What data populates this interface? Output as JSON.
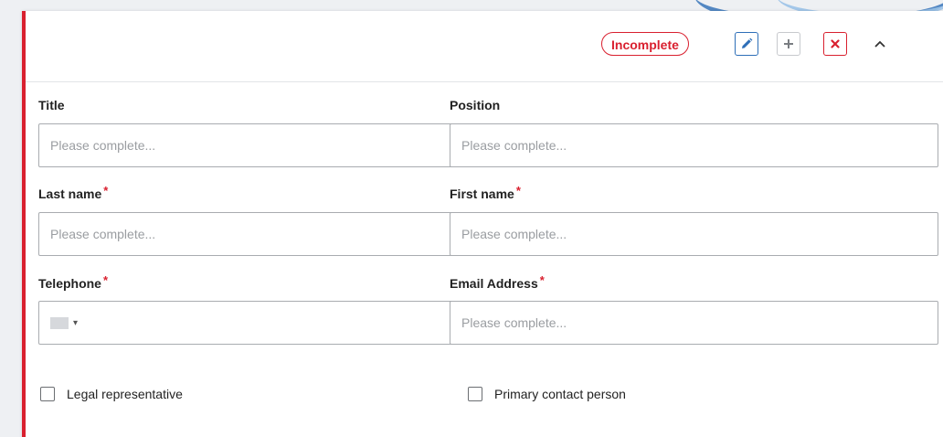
{
  "header": {
    "status_badge": "Incomplete"
  },
  "colors": {
    "accent_red": "#d9202f",
    "accent_blue": "#2e6fb8",
    "border_gray": "#a9acb0"
  },
  "icons": {
    "edit": "pencil-icon",
    "add": "plus-icon",
    "remove": "close-icon",
    "collapse": "chevron-up-icon"
  },
  "form": {
    "title": {
      "label": "Title",
      "placeholder": "Please complete...",
      "required": false
    },
    "position": {
      "label": "Position",
      "placeholder": "Please complete...",
      "required": false
    },
    "last_name": {
      "label": "Last name",
      "placeholder": "Please complete...",
      "required": true,
      "required_mark": "*"
    },
    "first_name": {
      "label": "First name",
      "placeholder": "Please complete...",
      "required": true,
      "required_mark": "*"
    },
    "telephone": {
      "label": "Telephone",
      "required": true,
      "required_mark": "*",
      "country_caret": "▾"
    },
    "email": {
      "label": "Email Address",
      "placeholder": "Please complete...",
      "required": true,
      "required_mark": "*"
    }
  },
  "checkboxes": {
    "legal_representative": {
      "label": "Legal representative",
      "checked": false
    },
    "primary_contact": {
      "label": "Primary contact person",
      "checked": false
    }
  }
}
